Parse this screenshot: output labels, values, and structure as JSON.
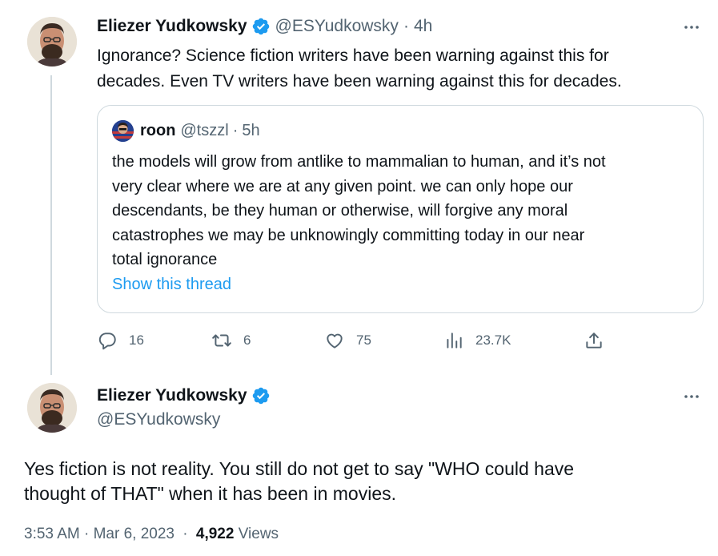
{
  "colors": {
    "accent": "#1d9bf0",
    "secondary_text": "#536471",
    "primary_text": "#0f1419",
    "border": "#cfd9de"
  },
  "parent_tweet": {
    "author_name": "Eliezer Yudkowsky",
    "handle": "@ESYudkowsky",
    "separator": "·",
    "time": "4h",
    "text_line1": "Ignorance?  Science fiction writers have been warning against this for",
    "text_line2": "decades.  Even TV writers have been warning against this for decades.",
    "quote": {
      "author_name": "roon",
      "handle": "@tszzl",
      "separator": "·",
      "time": "5h",
      "text_lines": [
        "the models will grow from antlike to mammalian to human, and it’s not",
        "very clear where we are at any given point. we can only hope our",
        "descendants, be they human or otherwise, will forgive any moral",
        "catastrophes we may be unknowingly committing today in our near",
        "total ignorance"
      ],
      "show_thread": "Show this thread"
    },
    "actions": {
      "replies": "16",
      "retweets": "6",
      "likes": "75",
      "views": "23.7K"
    },
    "icons": [
      "verified-badge-icon",
      "more-icon",
      "reply-icon",
      "retweet-icon",
      "like-icon",
      "views-icon",
      "share-icon"
    ]
  },
  "main_tweet": {
    "author_name": "Eliezer Yudkowsky",
    "handle": "@ESYudkowsky",
    "text_line1": "Yes fiction is not reality.  You still do not get to say \"WHO could have",
    "text_line2": "thought of THAT\" when it has been in movies.",
    "timestamp": "3:53 AM · Mar 6, 2023",
    "separator": "·",
    "views_count": "4,922",
    "views_label": "Views"
  }
}
